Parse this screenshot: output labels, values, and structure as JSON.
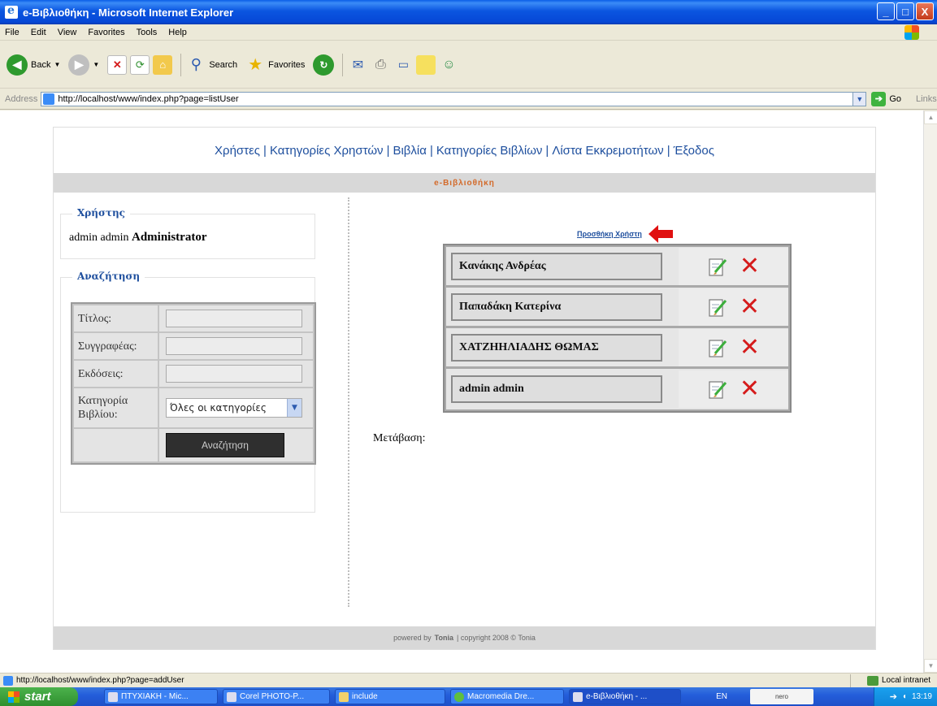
{
  "window": {
    "title": "e-Βιβλιοθήκη - Microsoft Internet Explorer",
    "min_label": "_",
    "max_label": "□",
    "close_label": "X"
  },
  "menu": [
    "File",
    "Edit",
    "View",
    "Favorites",
    "Tools",
    "Help"
  ],
  "toolbar": {
    "back": "Back",
    "search": "Search",
    "favorites": "Favorites"
  },
  "address": {
    "label": "Address",
    "url": "http://localhost/www/index.php?page=listUser",
    "go": "Go",
    "links": "Links"
  },
  "nav": {
    "items": [
      "Χρήστες",
      "Κατηγορίες Χρηστών",
      "Βιβλία",
      "Κατηγορίες Βιβλίων",
      "Λίστα Εκκρεμοτήτων",
      "Έξοδος"
    ],
    "separator": "|"
  },
  "brand": "e-Βιβλιοθήκη",
  "user_box": {
    "legend": "Χρήστης",
    "first": "admin",
    "last": "admin",
    "role": "Administrator"
  },
  "search_box": {
    "legend": "Αναζήτηση",
    "title_label": "Τίτλος:",
    "author_label": "Συγγραφέας:",
    "publisher_label": "Εκδόσεις:",
    "category_label": "Κατηγορία Βιβλίου:",
    "category_value": "Όλες οι κατηγορίες",
    "submit": "Αναζήτηση"
  },
  "add_user_link": "Προσθήκη Χρήστη",
  "users": [
    {
      "name": "Κανάκης Ανδρέας"
    },
    {
      "name": "Παπαδάκη Κατερίνα"
    },
    {
      "name": "ΧΑΤΖΗΗΛΙΑΔΗΣ ΘΩΜΑΣ"
    },
    {
      "name": "admin admin"
    }
  ],
  "pagination_label": "Μετάβαση:",
  "footer": {
    "text_before": "powered by",
    "author": "Tonia",
    "text_after": "| copyright 2008 © Tonia"
  },
  "status": {
    "url": "http://localhost/www/index.php?page=addUser",
    "zone": "Local intranet"
  },
  "taskbar": {
    "start": "start",
    "tasks": [
      "ΠΤΥΧΙΑΚΗ - Mic...",
      "Corel PHOTO-P...",
      "include",
      "Macromedia Dre...",
      "e-Βιβλιοθήκη - ..."
    ],
    "lang": "EN",
    "nero": "nero",
    "clock": "13:19"
  },
  "colors": {
    "link_blue": "#1e4f9e",
    "brand_orange": "#d36a2a",
    "delete_red": "#d51b1b"
  }
}
